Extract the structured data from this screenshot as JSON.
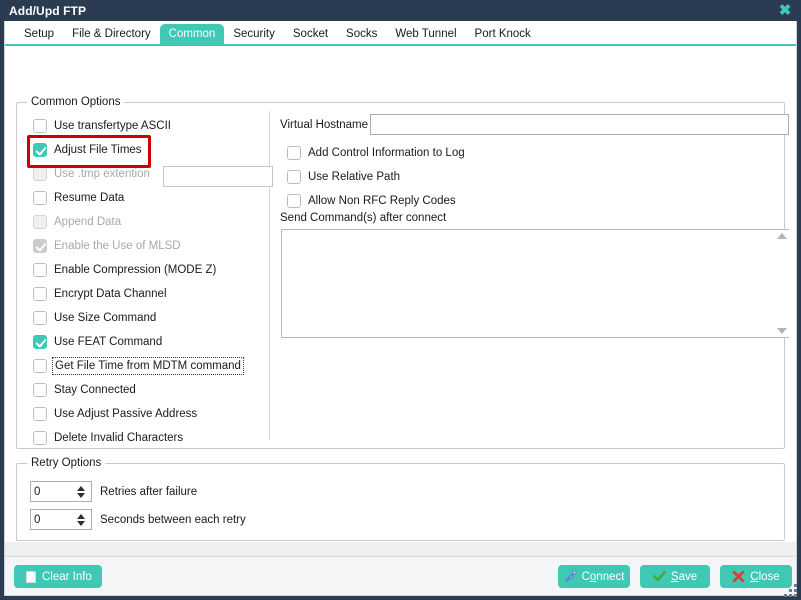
{
  "window": {
    "title": "Add/Upd FTP",
    "close_icon": "close-icon"
  },
  "tabs": [
    {
      "label": "Setup",
      "active": false
    },
    {
      "label": "File & Directory",
      "active": false
    },
    {
      "label": "Common",
      "active": true
    },
    {
      "label": "Security",
      "active": false
    },
    {
      "label": "Socket",
      "active": false
    },
    {
      "label": "Socks",
      "active": false
    },
    {
      "label": "Web Tunnel",
      "active": false
    },
    {
      "label": "Port Knock",
      "active": false
    }
  ],
  "common_options": {
    "legend": "Common Options",
    "left_checkboxes": [
      {
        "label": "Use transfertype ASCII",
        "checked": false,
        "disabled": false,
        "focused": false,
        "highlighted": false
      },
      {
        "label": "Adjust File Times",
        "checked": true,
        "disabled": false,
        "focused": false,
        "highlighted": true
      },
      {
        "label": "Use .tmp extention",
        "checked": false,
        "disabled": true,
        "focused": false,
        "highlighted": false
      },
      {
        "label": "Resume Data",
        "checked": false,
        "disabled": false,
        "focused": false,
        "highlighted": false
      },
      {
        "label": "Append Data",
        "checked": false,
        "disabled": true,
        "focused": false,
        "highlighted": false
      },
      {
        "label": "Enable the Use of MLSD",
        "checked": true,
        "disabled": true,
        "focused": false,
        "highlighted": false
      },
      {
        "label": "Enable Compression (MODE Z)",
        "checked": false,
        "disabled": false,
        "focused": false,
        "highlighted": false
      },
      {
        "label": "Encrypt Data Channel",
        "checked": false,
        "disabled": false,
        "focused": false,
        "highlighted": false
      },
      {
        "label": "Use Size Command",
        "checked": false,
        "disabled": false,
        "focused": false,
        "highlighted": false
      },
      {
        "label": "Use FEAT Command",
        "checked": true,
        "disabled": false,
        "focused": false,
        "highlighted": false
      },
      {
        "label": "Get File Time from MDTM command",
        "checked": false,
        "disabled": false,
        "focused": true,
        "highlighted": false
      },
      {
        "label": "Stay Connected",
        "checked": false,
        "disabled": false,
        "focused": false,
        "highlighted": false
      },
      {
        "label": "Use Adjust Passive Address",
        "checked": false,
        "disabled": false,
        "focused": false,
        "highlighted": false
      },
      {
        "label": "Delete Invalid Characters",
        "checked": false,
        "disabled": false,
        "focused": false,
        "highlighted": false
      }
    ],
    "tmp_extension_value": "",
    "tmp_extension_placeholder": "",
    "virtual_hostname_label": "Virtual Hostname",
    "virtual_hostname_value": "",
    "virtual_hostname_placeholder": "",
    "right_checkboxes": [
      {
        "label": "Add Control Information to Log",
        "checked": false
      },
      {
        "label": "Use Relative Path",
        "checked": false
      },
      {
        "label": "Allow Non RFC Reply Codes",
        "checked": false
      }
    ],
    "send_commands_label": "Send Command(s) after connect",
    "send_commands_value": "",
    "send_commands_placeholder": ""
  },
  "retry_options": {
    "legend": "Retry Options",
    "rows": [
      {
        "value": "0",
        "label": "Retries after failure"
      },
      {
        "value": "0",
        "label": "Seconds between each retry"
      }
    ]
  },
  "footer": {
    "clear_info": {
      "label": "Clear Info",
      "icon": "document-icon"
    },
    "connect": {
      "label_pre": "C",
      "label_accel": "o",
      "label_post": "nnect",
      "icon": "plug-icon"
    },
    "save": {
      "label_pre": "",
      "label_accel": "S",
      "label_post": "ave",
      "icon": "checkmark-icon"
    },
    "close": {
      "label_pre": "",
      "label_accel": "C",
      "label_post": "lose",
      "icon": "x-icon"
    }
  },
  "colors": {
    "accent": "#3fc8b4",
    "titlebar": "#2b3b52",
    "highlight": "#cc0000"
  }
}
